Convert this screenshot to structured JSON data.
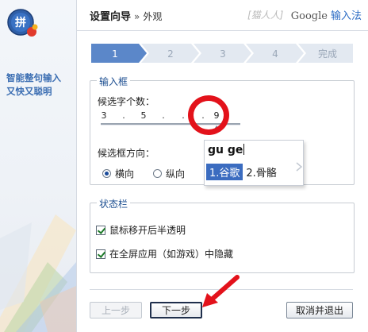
{
  "sidebar": {
    "slogan": [
      "智能整句输入",
      "又快又聪明"
    ]
  },
  "header": {
    "wizard_title": "设置向导",
    "separator": "»",
    "page_title": "外观",
    "watermark": "[猫人人]",
    "brand_google": "Google",
    "brand_ime": "输入法"
  },
  "steps": [
    {
      "label": "1",
      "active": true
    },
    {
      "label": "2",
      "active": false
    },
    {
      "label": "3",
      "active": false
    },
    {
      "label": "4",
      "active": false
    },
    {
      "label": "完成",
      "active": false
    }
  ],
  "input_box": {
    "legend": "输入框",
    "candidate_count_label": "候选字个数：",
    "slider": {
      "tick_labels": [
        "3",
        ".",
        "5",
        ".",
        ".",
        ".",
        "9"
      ],
      "min": 3,
      "max": 9,
      "value": 9
    },
    "direction_label": "候选框方向：",
    "direction_options": [
      {
        "label": "横向",
        "selected": true
      },
      {
        "label": "纵向",
        "selected": false
      }
    ],
    "preview": {
      "input_text": "gu ge",
      "candidates": [
        "1.谷歌",
        "2.骨骼"
      ],
      "selected_index": 0
    }
  },
  "status_bar": {
    "legend": "状态栏",
    "options": [
      {
        "label": "鼠标移开后半透明",
        "checked": true
      },
      {
        "label": "在全屏应用（如游戏）中隐藏",
        "checked": true
      }
    ]
  },
  "buttons": {
    "prev": "上一步",
    "next": "下一步",
    "cancel": "取消并退出"
  },
  "colors": {
    "accent": "#3b6cc0",
    "step_active": "#5b87c9",
    "step_inactive": "#e3e9f1",
    "annotation": "#e3121b"
  }
}
